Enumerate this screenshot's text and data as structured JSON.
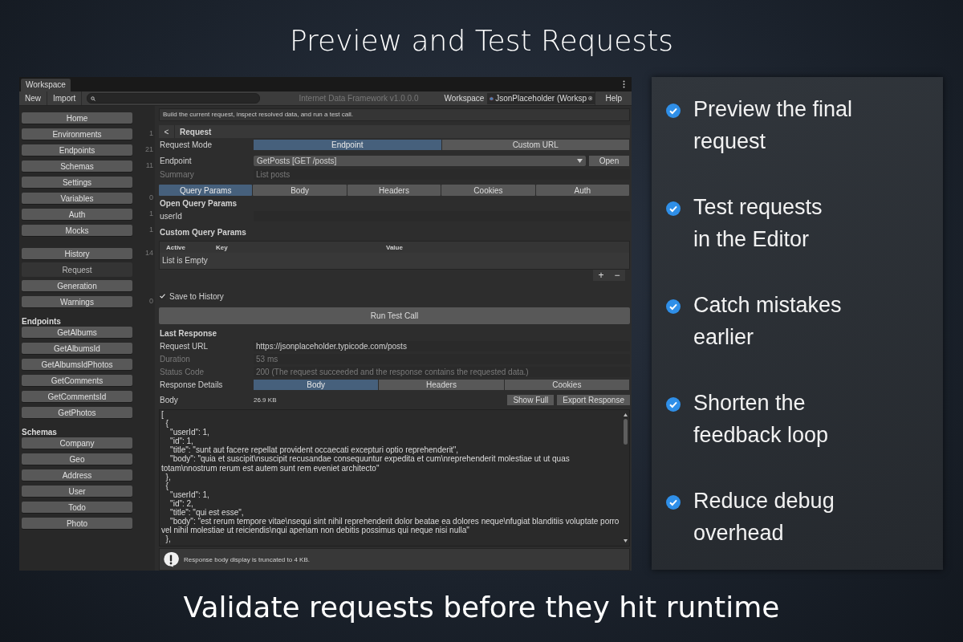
{
  "headline": "Preview and Test Requests",
  "window": {
    "tab": "Workspace",
    "toolbar": {
      "buttons": [
        "New",
        "Import"
      ],
      "title": "Internet Data Framework v1.0.0.0",
      "workspace_label": "Workspace",
      "workspace_value": "JsonPlaceholder (Worksp",
      "help": "Help"
    },
    "sidebar": {
      "nav_groups": [
        [
          {
            "label": "Home",
            "selected": false
          },
          {
            "label": "Environments",
            "count": "1",
            "selected": false
          },
          {
            "label": "Endpoints",
            "count": "21",
            "selected": false
          },
          {
            "label": "Schemas",
            "count": "11",
            "selected": false
          },
          {
            "label": "Settings",
            "selected": false
          },
          {
            "label": "Variables",
            "count": "0",
            "selected": false
          },
          {
            "label": "Auth",
            "count": "1",
            "selected": false
          },
          {
            "label": "Mocks",
            "count": "1",
            "selected": false
          }
        ],
        [
          {
            "label": "History",
            "count": "14",
            "selected": false
          },
          {
            "label": "Request",
            "selected": true
          },
          {
            "label": "Generation",
            "selected": false
          },
          {
            "label": "Warnings",
            "count": "0",
            "selected": false
          }
        ]
      ],
      "sections": [
        {
          "title": "Endpoints",
          "items": [
            "GetAlbums",
            "GetAlbumsId",
            "GetAlbumsIdPhotos",
            "GetComments",
            "GetCommentsId",
            "GetPhotos"
          ]
        },
        {
          "title": "Schemas",
          "items": [
            "Company",
            "Geo",
            "Address",
            "User",
            "Todo",
            "Photo"
          ]
        }
      ]
    },
    "content": {
      "description": "Build the current request, inspect resolved data, and run a test call.",
      "header": {
        "back": "<",
        "title": "Request"
      },
      "request_mode": {
        "label": "Request Mode",
        "options": [
          {
            "label": "Endpoint",
            "selected": true
          },
          {
            "label": "Custom URL",
            "selected": false
          }
        ]
      },
      "endpoint": {
        "label": "Endpoint",
        "value": "GetPosts [GET /posts]",
        "button": "Open"
      },
      "summary": {
        "label": "Summary",
        "value": "List posts",
        "disabled": true
      },
      "param_tabs": [
        {
          "label": "Query Params",
          "selected": true
        },
        {
          "label": "Body",
          "selected": false
        },
        {
          "label": "Headers",
          "selected": false
        },
        {
          "label": "Cookies",
          "selected": false
        },
        {
          "label": "Auth",
          "selected": false
        }
      ],
      "open_query_params": {
        "title": "Open Query Params",
        "fields": [
          {
            "label": "userId"
          }
        ]
      },
      "custom_query_params": {
        "title": "Custom Query Params",
        "columns": [
          "Active",
          "Key",
          "Value"
        ],
        "empty": "List is Empty",
        "add": "+",
        "remove": "−"
      },
      "save_to_history": {
        "label": "Save to History",
        "checked": true
      },
      "run_button": "Run Test Call",
      "last_response": {
        "title": "Last Response",
        "fields": [
          {
            "label": "Request URL",
            "value": "https://jsonplaceholder.typicode.com/posts",
            "disabled": false
          },
          {
            "label": "Duration",
            "value": "53 ms",
            "disabled": true
          },
          {
            "label": "Status Code",
            "value": "200 (The request succeeded and the response contains the requested data.)",
            "disabled": true
          }
        ],
        "details_label": "Response Details",
        "details_tabs": [
          {
            "label": "Body",
            "selected": true
          },
          {
            "label": "Headers",
            "selected": false
          },
          {
            "label": "Cookies",
            "selected": false
          }
        ],
        "body_label": "Body",
        "body_size": "26.9 KB",
        "buttons": [
          "Show Full",
          "Export Response"
        ],
        "body_lines": [
          "[",
          "  {",
          "    \"userId\": 1,",
          "    \"id\": 1,",
          "    \"title\": \"sunt aut facere repellat provident occaecati excepturi optio reprehenderit\",",
          "    \"body\": \"quia et suscipit\\nsuscipit recusandae consequuntur expedita et cum\\nreprehenderit molestiae ut ut quas",
          "totam\\nnostrum rerum est autem sunt rem eveniet architecto\"",
          "  },",
          "  {",
          "    \"userId\": 1,",
          "    \"id\": 2,",
          "    \"title\": \"qui est esse\",",
          "    \"body\": \"est rerum tempore vitae\\nsequi sint nihil reprehenderit dolor beatae ea dolores neque\\nfugiat blanditiis voluptate porro",
          "vel nihil molestiae ut reiciendis\\nqui aperiam non debitis possimus qui neque nisi nulla\"",
          "  },"
        ],
        "notice": "Response body display is truncated to 4 KB."
      }
    }
  },
  "features": [
    {
      "lines": [
        "Preview the final",
        "request"
      ]
    },
    {
      "lines": [
        "Test requests",
        "in the Editor"
      ]
    },
    {
      "lines": [
        "Catch mistakes",
        "earlier"
      ]
    },
    {
      "lines": [
        "Shorten the",
        "feedback loop"
      ]
    },
    {
      "lines": [
        "Reduce debug",
        "overhead"
      ]
    }
  ],
  "caption": "Validate requests before they hit runtime"
}
